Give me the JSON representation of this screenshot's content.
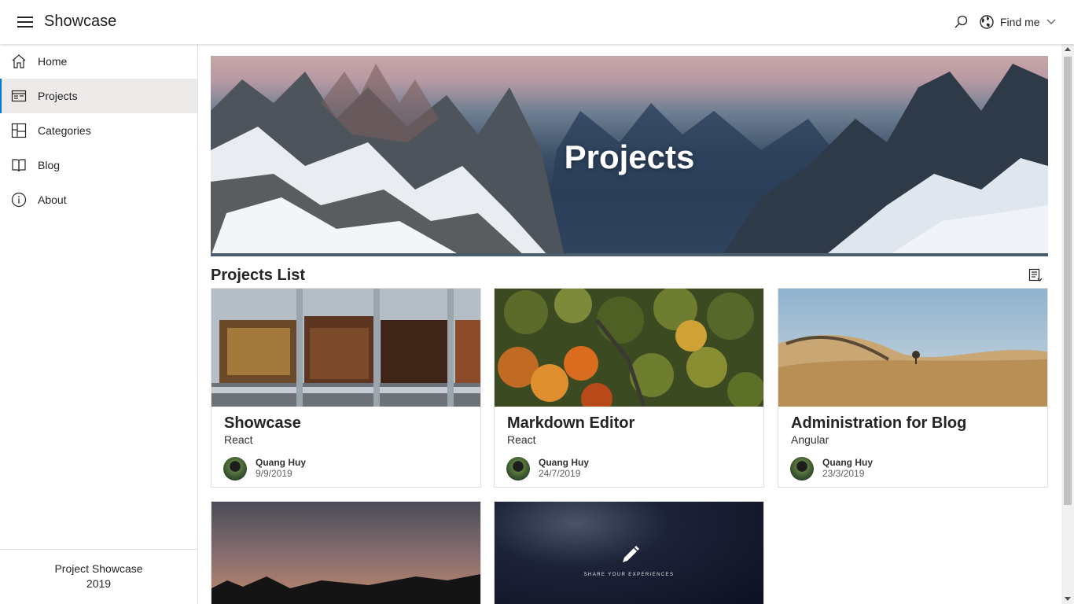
{
  "header": {
    "title": "Showcase",
    "menu_icon": "hamburger-icon",
    "search_icon": "search-icon",
    "findme_icon": "globe-icon",
    "findme_label": "Find me"
  },
  "sidebar": {
    "items": [
      {
        "label": "Home",
        "icon": "home-icon",
        "active": false
      },
      {
        "label": "Projects",
        "icon": "projects-icon",
        "active": true
      },
      {
        "label": "Categories",
        "icon": "categories-icon",
        "active": false
      },
      {
        "label": "Blog",
        "icon": "book-icon",
        "active": false
      },
      {
        "label": "About",
        "icon": "info-icon",
        "active": false
      }
    ],
    "footer_line1": "Project Showcase",
    "footer_line2": "2019"
  },
  "hero": {
    "title": "Projects"
  },
  "projects": {
    "section_title": "Projects List",
    "view_toggle_icon": "list-view-icon",
    "cards": [
      {
        "title": "Showcase",
        "category": "React",
        "author": "Quang Huy",
        "date": "9/9/2019"
      },
      {
        "title": "Markdown Editor",
        "category": "React",
        "author": "Quang Huy",
        "date": "24/7/2019"
      },
      {
        "title": "Administration for Blog",
        "category": "Angular",
        "author": "Quang Huy",
        "date": "23/3/2019"
      }
    ],
    "share_text": "Share your experiences"
  },
  "colors": {
    "accent": "#0078d4",
    "active_bg": "#edebe9",
    "border": "#e1dfdd"
  }
}
